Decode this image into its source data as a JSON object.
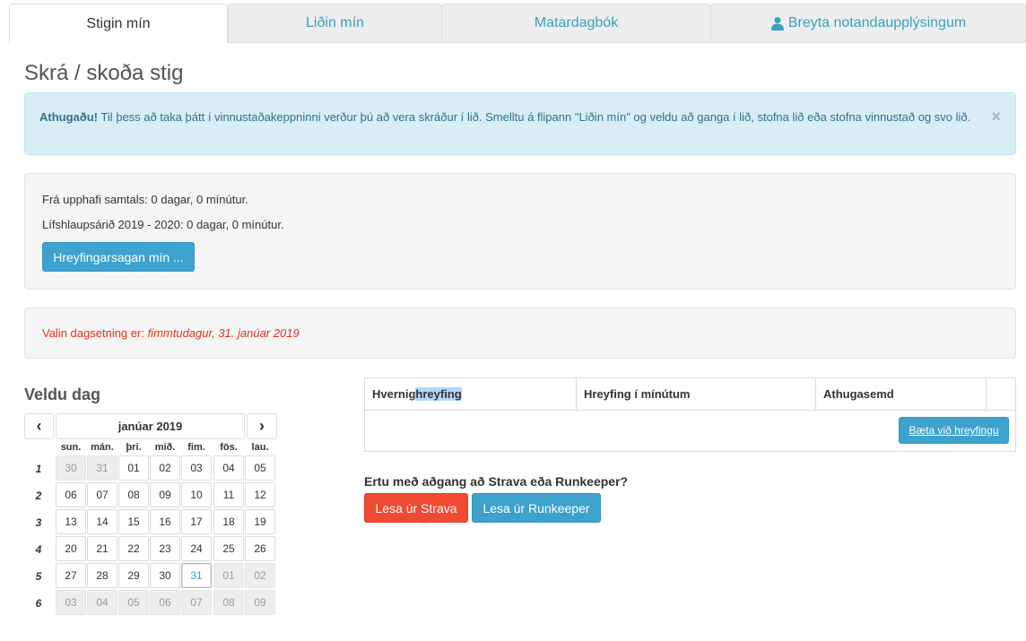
{
  "tabs": [
    {
      "label": "Stigin mín"
    },
    {
      "label": "Liðin mín"
    },
    {
      "label": "Matardagbók"
    },
    {
      "label": "Breyta notandaupplýsingum",
      "icon": "user-icon"
    }
  ],
  "page_title": "Skrá / skoða stig",
  "alert": {
    "strong": "Athugaðu!",
    "text": " Til þess að taka þátt í vinnustaðakeppninni verður þú að vera skráður í lið. Smelltu á flipann \"Liðin mín\" og veldu að ganga í lið, stofna lið eða stofna vinnustað og svo lið.",
    "close": "×"
  },
  "summary": {
    "total": "Frá upphafi samtals: 0 dagar, 0 mínútur.",
    "season": "Lífshlaupsárið 2019 - 2020: 0 dagar, 0 mínútur.",
    "history_button": "Hreyfingarsagan mín ..."
  },
  "selected_date": {
    "label": "Valin dagsetning er: ",
    "value": "fimmtudagur, 31. janúar 2019"
  },
  "calendar": {
    "title": "Veldu dag",
    "prev": "‹",
    "next": "›",
    "month": "janúar 2019",
    "weekdays": [
      "sun.",
      "mán.",
      "þri.",
      "mið.",
      "fim.",
      "fös.",
      "lau."
    ],
    "weeks": [
      {
        "num": "1",
        "days": [
          "30",
          "31",
          "01",
          "02",
          "03",
          "04",
          "05"
        ]
      },
      {
        "num": "2",
        "days": [
          "06",
          "07",
          "08",
          "09",
          "10",
          "11",
          "12"
        ]
      },
      {
        "num": "3",
        "days": [
          "13",
          "14",
          "15",
          "16",
          "17",
          "18",
          "19"
        ]
      },
      {
        "num": "4",
        "days": [
          "20",
          "21",
          "22",
          "23",
          "24",
          "25",
          "26"
        ]
      },
      {
        "num": "5",
        "days": [
          "27",
          "28",
          "29",
          "30",
          "31",
          "01",
          "02"
        ]
      },
      {
        "num": "6",
        "days": [
          "03",
          "04",
          "05",
          "06",
          "07",
          "08",
          "09"
        ]
      }
    ]
  },
  "table": {
    "col1_prefix": "Hvernig ",
    "col1_highlight": "hreyfing",
    "col2": "Hreyfing í mínútum",
    "col3": "Athugasemd",
    "add_button": "Bæta við hreyfingu"
  },
  "integrations": {
    "question": "Ertu með aðgang að Strava eða Runkeeper?",
    "strava_button": "Lesa úr Strava",
    "runkeeper_button": "Lesa úr Runkeeper"
  },
  "colors": {
    "accent": "#3ea2cf",
    "danger": "#f14a32",
    "alert_bg": "#d9edf7",
    "date_text": "#e2311d"
  }
}
